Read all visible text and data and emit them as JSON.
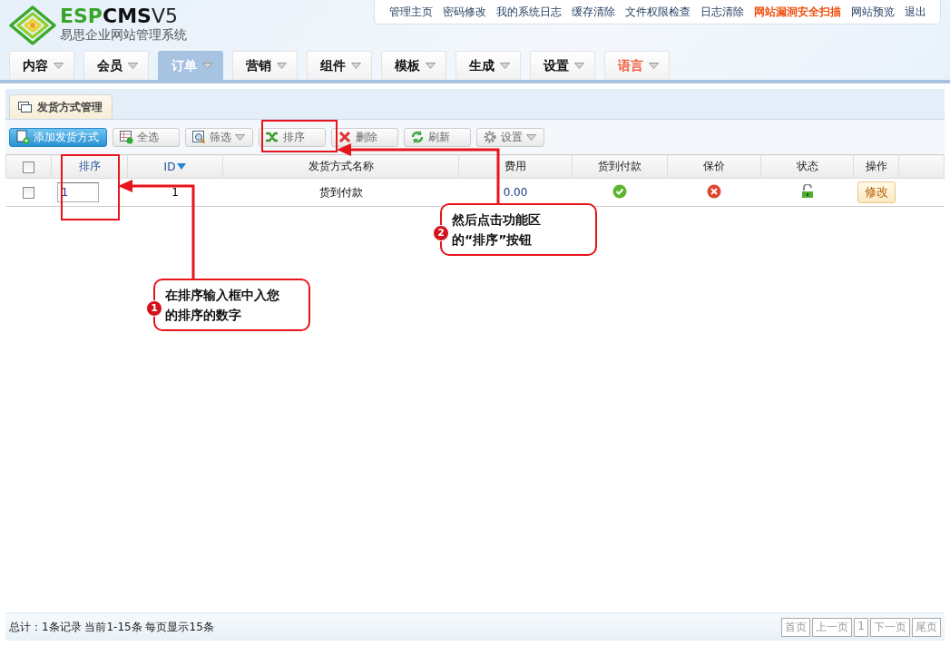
{
  "logo": {
    "brand_parts": [
      "ESP",
      "CMS"
    ],
    "version": "V5",
    "subtitle": "易思企业网站管理系统"
  },
  "top_links": [
    {
      "label": "管理主页",
      "highlight": false
    },
    {
      "label": "密码修改",
      "highlight": false
    },
    {
      "label": "我的系统日志",
      "highlight": false
    },
    {
      "label": "缓存清除",
      "highlight": false
    },
    {
      "label": "文件权限检查",
      "highlight": false
    },
    {
      "label": "日志清除",
      "highlight": false
    },
    {
      "label": "网站漏洞安全扫描",
      "highlight": true
    },
    {
      "label": "网站预览",
      "highlight": false
    },
    {
      "label": "退出",
      "highlight": false
    }
  ],
  "nav_tabs": [
    {
      "label": "内容",
      "selected": false,
      "highlight": false
    },
    {
      "label": "会员",
      "selected": false,
      "highlight": false
    },
    {
      "label": "订单",
      "selected": true,
      "highlight": false
    },
    {
      "label": "营销",
      "selected": false,
      "highlight": false
    },
    {
      "label": "组件",
      "selected": false,
      "highlight": false
    },
    {
      "label": "模板",
      "selected": false,
      "highlight": false
    },
    {
      "label": "生成",
      "selected": false,
      "highlight": false
    },
    {
      "label": "设置",
      "selected": false,
      "highlight": false
    },
    {
      "label": "语言",
      "selected": false,
      "highlight": true
    }
  ],
  "panel": {
    "title": "发货方式管理"
  },
  "toolbar": [
    {
      "label": "添加发货方式",
      "primary": true,
      "dropdown": false
    },
    {
      "label": "全选",
      "primary": false,
      "dropdown": false
    },
    {
      "label": "筛选",
      "primary": false,
      "dropdown": true
    },
    {
      "label": "排序",
      "primary": false,
      "dropdown": false
    },
    {
      "label": "删除",
      "primary": false,
      "dropdown": false
    },
    {
      "label": "刷新",
      "primary": false,
      "dropdown": false
    },
    {
      "label": "设置",
      "primary": false,
      "dropdown": true
    }
  ],
  "table": {
    "select_all": {
      "checked": false
    },
    "columns": [
      {
        "label": "排序",
        "sorted": false,
        "link": true
      },
      {
        "label": "ID",
        "sorted": true,
        "link": true
      },
      {
        "label": "发货方式名称",
        "sorted": false,
        "link": false
      },
      {
        "label": "费用",
        "sorted": false,
        "link": false
      },
      {
        "label": "货到付款",
        "sorted": false,
        "link": false
      },
      {
        "label": "保价",
        "sorted": false,
        "link": false
      },
      {
        "label": "状态",
        "sorted": false,
        "link": false
      },
      {
        "label": "操作",
        "sorted": false,
        "link": false
      }
    ],
    "rows": [
      {
        "checked": false,
        "order": "1",
        "id": "1",
        "name": "货到付款",
        "fee": "0.00",
        "cod": true,
        "insured": false,
        "locked": false,
        "action": "修改"
      }
    ]
  },
  "annotations": [
    {
      "number": "1",
      "text": "在排序输入框中入您的排序的数字"
    },
    {
      "number": "2",
      "text": "然后点击功能区的“排序”按钮"
    }
  ],
  "footer": {
    "summary": "总计：1条记录 当前1-15条 每页显示15条",
    "pages": [
      "首页",
      "上一页",
      "1",
      "下一页",
      "尾页"
    ]
  }
}
